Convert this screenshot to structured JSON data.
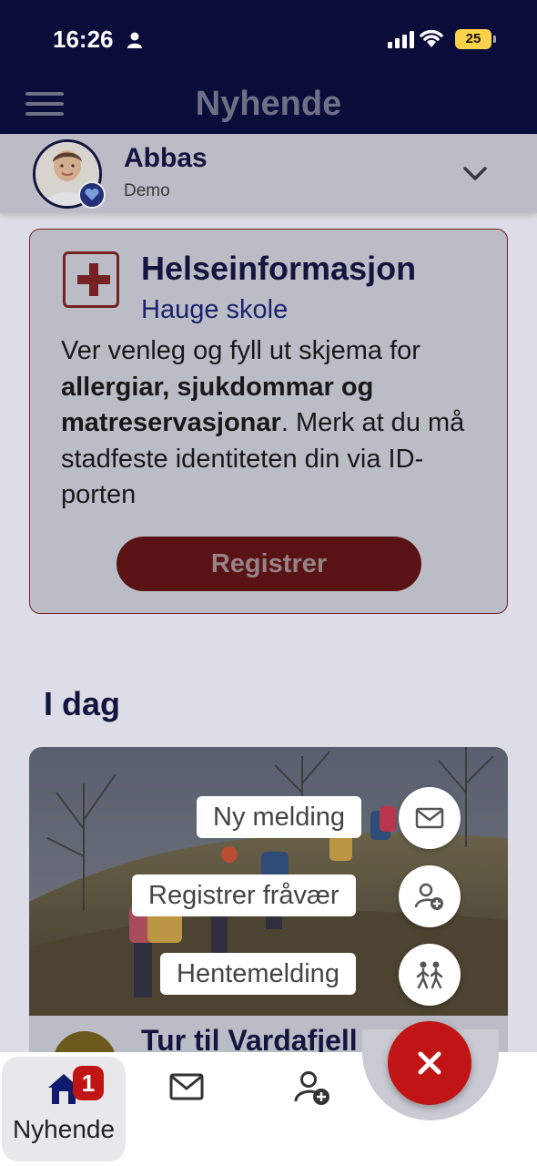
{
  "status": {
    "time": "16:26",
    "battery": "25"
  },
  "header": {
    "title": "Nyhende"
  },
  "profile": {
    "name": "Abbas",
    "subtitle": "Demo"
  },
  "health_card": {
    "title": "Helseinformasjon",
    "subtitle": "Hauge skole",
    "text_1": "Ver venleg og fyll ut skjema for",
    "text_bold": "allergiar, sjukdommar og matreservasjonar",
    "text_2": ". Merk at du må stadfeste identiteten din via ID-porten",
    "button_label": "Registrer"
  },
  "today": {
    "section_title": "I dag",
    "event_title": "Tur til Vardafjell"
  },
  "fab_menu": {
    "items": [
      {
        "label": "Ny melding",
        "icon": "mail-icon"
      },
      {
        "label": "Registrer fråvær",
        "icon": "person-add-icon"
      },
      {
        "label": "Hentemelding",
        "icon": "walking-kids-icon"
      }
    ],
    "close_icon": "close-icon"
  },
  "bottom_nav": {
    "home_label": "Nyhende",
    "home_badge": "1",
    "items": [
      "home-icon",
      "mail-icon",
      "person-add-icon"
    ]
  },
  "colors": {
    "navy": "#0a0c3a",
    "red": "#c11414",
    "battery": "#fbd34a"
  }
}
